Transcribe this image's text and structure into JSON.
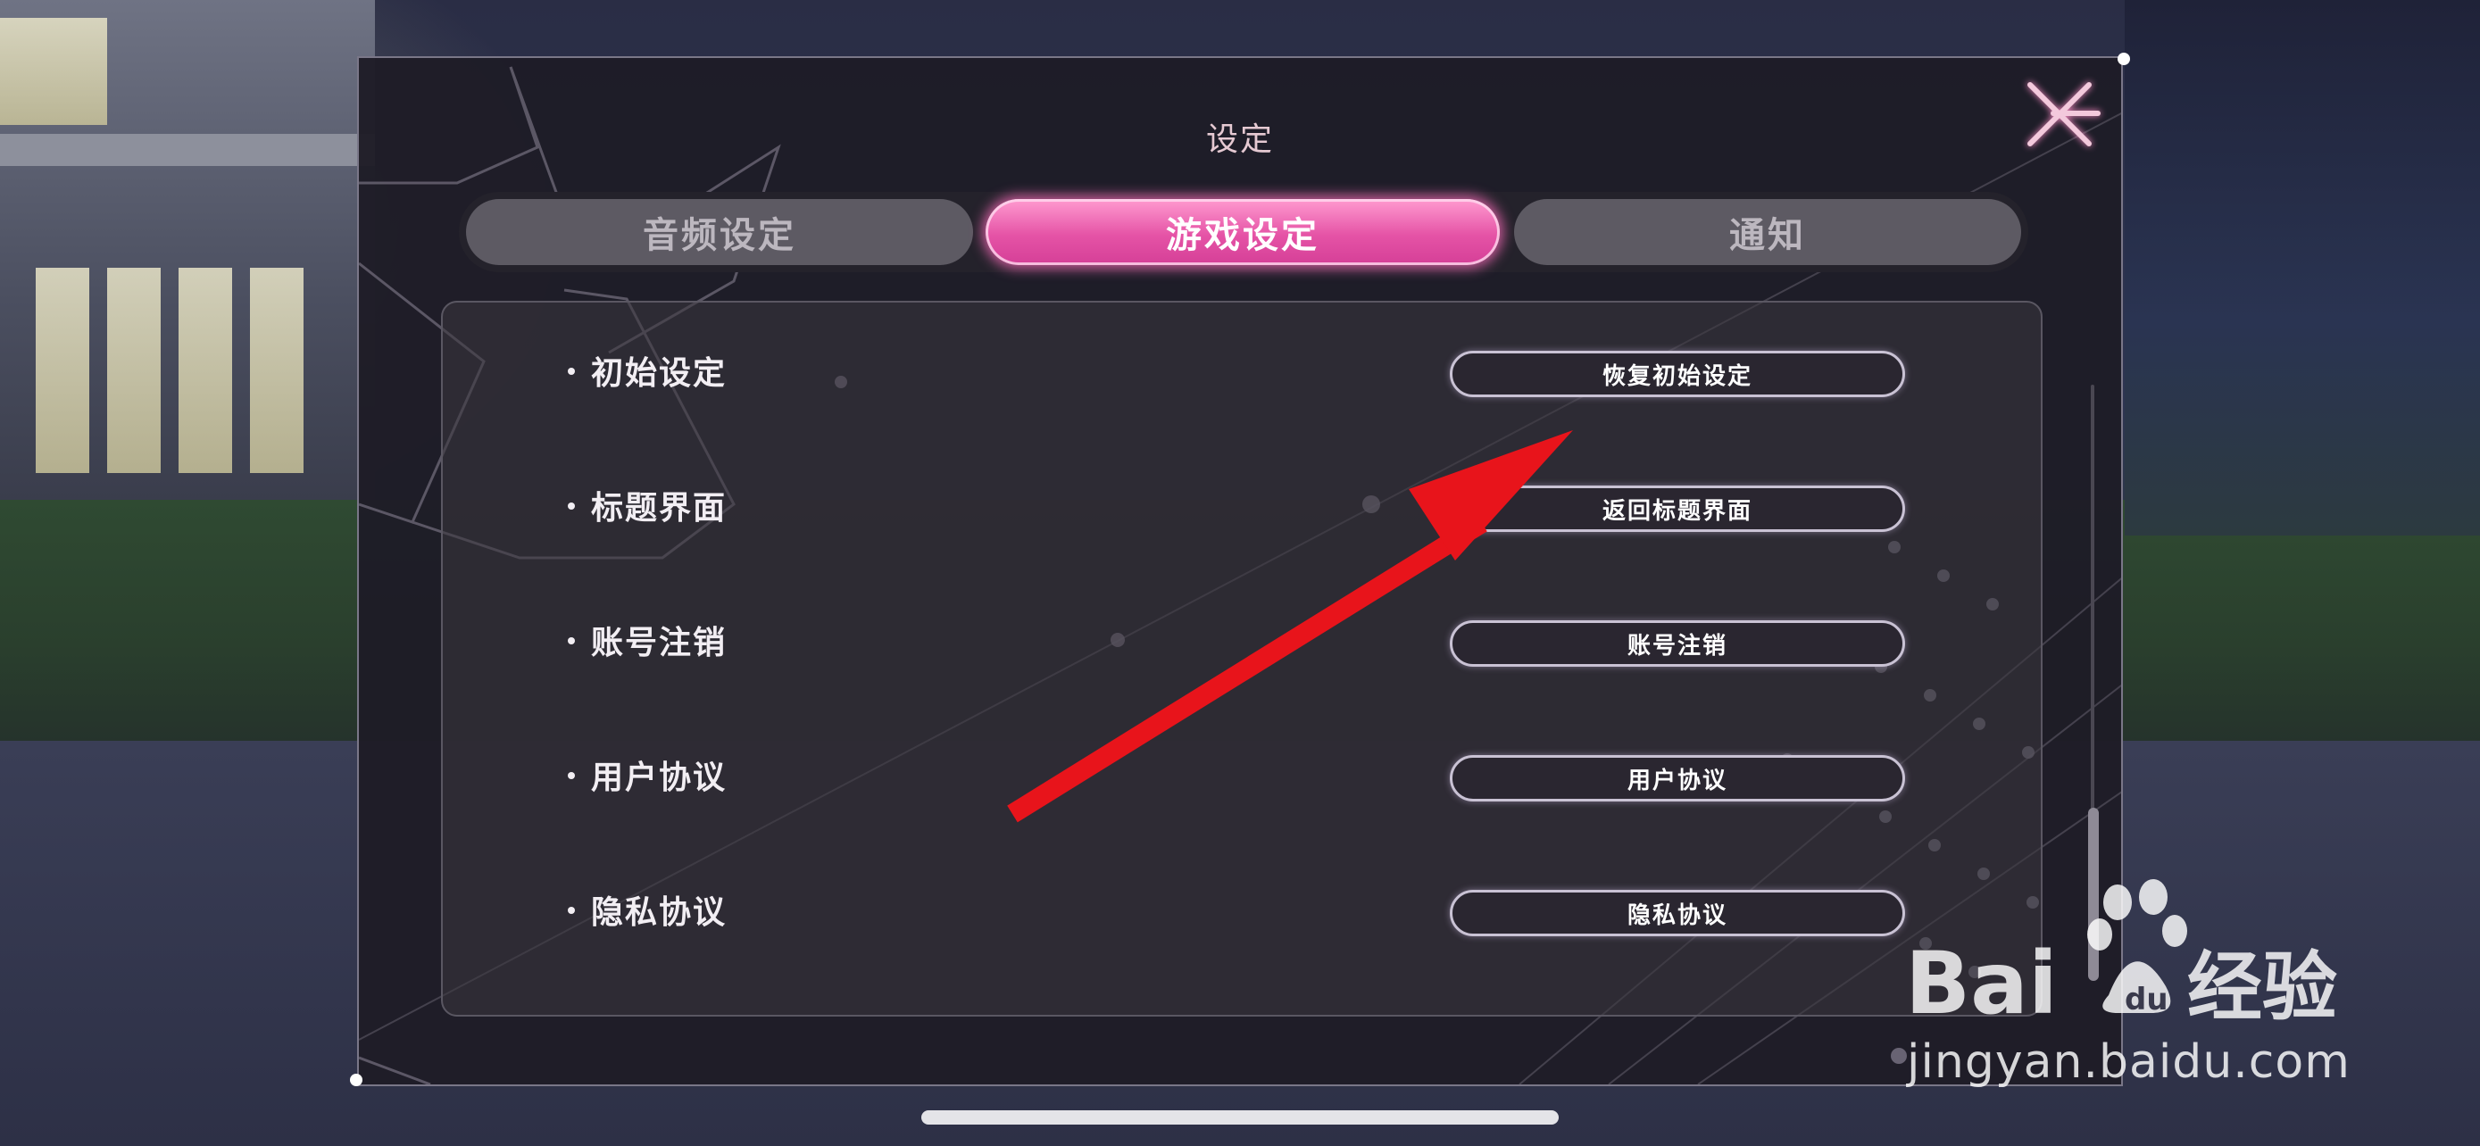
{
  "panel": {
    "title": "设定",
    "close_icon": "close-x-icon"
  },
  "tabs": [
    {
      "label": "音频设定",
      "active": false
    },
    {
      "label": "游戏设定",
      "active": true
    },
    {
      "label": "通知",
      "active": false
    }
  ],
  "settings": [
    {
      "label": "初始设定",
      "button": "恢复初始设定"
    },
    {
      "label": "标题界面",
      "button": "返回标题界面"
    },
    {
      "label": "账号注销",
      "button": "账号注销"
    },
    {
      "label": "用户协议",
      "button": "用户协议"
    },
    {
      "label": "隐私协议",
      "button": "隐私协议"
    }
  ],
  "colors": {
    "active_tab": "#e553a6",
    "arrow": "#e8141b",
    "panel_bg": "#1e1c26"
  },
  "watermark": {
    "brand": "Bai经验",
    "url": "jingyan.baidu.com"
  }
}
